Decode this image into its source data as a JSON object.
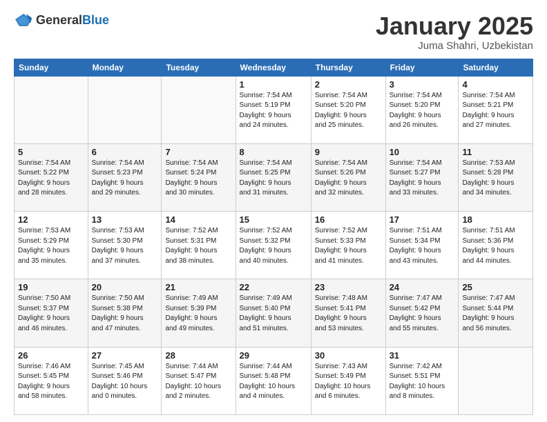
{
  "header": {
    "logo_general": "General",
    "logo_blue": "Blue",
    "month_title": "January 2025",
    "location": "Juma Shahri, Uzbekistan"
  },
  "weekdays": [
    "Sunday",
    "Monday",
    "Tuesday",
    "Wednesday",
    "Thursday",
    "Friday",
    "Saturday"
  ],
  "weeks": [
    [
      {
        "day": "",
        "info": ""
      },
      {
        "day": "",
        "info": ""
      },
      {
        "day": "",
        "info": ""
      },
      {
        "day": "1",
        "info": "Sunrise: 7:54 AM\nSunset: 5:19 PM\nDaylight: 9 hours\nand 24 minutes."
      },
      {
        "day": "2",
        "info": "Sunrise: 7:54 AM\nSunset: 5:20 PM\nDaylight: 9 hours\nand 25 minutes."
      },
      {
        "day": "3",
        "info": "Sunrise: 7:54 AM\nSunset: 5:20 PM\nDaylight: 9 hours\nand 26 minutes."
      },
      {
        "day": "4",
        "info": "Sunrise: 7:54 AM\nSunset: 5:21 PM\nDaylight: 9 hours\nand 27 minutes."
      }
    ],
    [
      {
        "day": "5",
        "info": "Sunrise: 7:54 AM\nSunset: 5:22 PM\nDaylight: 9 hours\nand 28 minutes."
      },
      {
        "day": "6",
        "info": "Sunrise: 7:54 AM\nSunset: 5:23 PM\nDaylight: 9 hours\nand 29 minutes."
      },
      {
        "day": "7",
        "info": "Sunrise: 7:54 AM\nSunset: 5:24 PM\nDaylight: 9 hours\nand 30 minutes."
      },
      {
        "day": "8",
        "info": "Sunrise: 7:54 AM\nSunset: 5:25 PM\nDaylight: 9 hours\nand 31 minutes."
      },
      {
        "day": "9",
        "info": "Sunrise: 7:54 AM\nSunset: 5:26 PM\nDaylight: 9 hours\nand 32 minutes."
      },
      {
        "day": "10",
        "info": "Sunrise: 7:54 AM\nSunset: 5:27 PM\nDaylight: 9 hours\nand 33 minutes."
      },
      {
        "day": "11",
        "info": "Sunrise: 7:53 AM\nSunset: 5:28 PM\nDaylight: 9 hours\nand 34 minutes."
      }
    ],
    [
      {
        "day": "12",
        "info": "Sunrise: 7:53 AM\nSunset: 5:29 PM\nDaylight: 9 hours\nand 35 minutes."
      },
      {
        "day": "13",
        "info": "Sunrise: 7:53 AM\nSunset: 5:30 PM\nDaylight: 9 hours\nand 37 minutes."
      },
      {
        "day": "14",
        "info": "Sunrise: 7:52 AM\nSunset: 5:31 PM\nDaylight: 9 hours\nand 38 minutes."
      },
      {
        "day": "15",
        "info": "Sunrise: 7:52 AM\nSunset: 5:32 PM\nDaylight: 9 hours\nand 40 minutes."
      },
      {
        "day": "16",
        "info": "Sunrise: 7:52 AM\nSunset: 5:33 PM\nDaylight: 9 hours\nand 41 minutes."
      },
      {
        "day": "17",
        "info": "Sunrise: 7:51 AM\nSunset: 5:34 PM\nDaylight: 9 hours\nand 43 minutes."
      },
      {
        "day": "18",
        "info": "Sunrise: 7:51 AM\nSunset: 5:36 PM\nDaylight: 9 hours\nand 44 minutes."
      }
    ],
    [
      {
        "day": "19",
        "info": "Sunrise: 7:50 AM\nSunset: 5:37 PM\nDaylight: 9 hours\nand 46 minutes."
      },
      {
        "day": "20",
        "info": "Sunrise: 7:50 AM\nSunset: 5:38 PM\nDaylight: 9 hours\nand 47 minutes."
      },
      {
        "day": "21",
        "info": "Sunrise: 7:49 AM\nSunset: 5:39 PM\nDaylight: 9 hours\nand 49 minutes."
      },
      {
        "day": "22",
        "info": "Sunrise: 7:49 AM\nSunset: 5:40 PM\nDaylight: 9 hours\nand 51 minutes."
      },
      {
        "day": "23",
        "info": "Sunrise: 7:48 AM\nSunset: 5:41 PM\nDaylight: 9 hours\nand 53 minutes."
      },
      {
        "day": "24",
        "info": "Sunrise: 7:47 AM\nSunset: 5:42 PM\nDaylight: 9 hours\nand 55 minutes."
      },
      {
        "day": "25",
        "info": "Sunrise: 7:47 AM\nSunset: 5:44 PM\nDaylight: 9 hours\nand 56 minutes."
      }
    ],
    [
      {
        "day": "26",
        "info": "Sunrise: 7:46 AM\nSunset: 5:45 PM\nDaylight: 9 hours\nand 58 minutes."
      },
      {
        "day": "27",
        "info": "Sunrise: 7:45 AM\nSunset: 5:46 PM\nDaylight: 10 hours\nand 0 minutes."
      },
      {
        "day": "28",
        "info": "Sunrise: 7:44 AM\nSunset: 5:47 PM\nDaylight: 10 hours\nand 2 minutes."
      },
      {
        "day": "29",
        "info": "Sunrise: 7:44 AM\nSunset: 5:48 PM\nDaylight: 10 hours\nand 4 minutes."
      },
      {
        "day": "30",
        "info": "Sunrise: 7:43 AM\nSunset: 5:49 PM\nDaylight: 10 hours\nand 6 minutes."
      },
      {
        "day": "31",
        "info": "Sunrise: 7:42 AM\nSunset: 5:51 PM\nDaylight: 10 hours\nand 8 minutes."
      },
      {
        "day": "",
        "info": ""
      }
    ]
  ]
}
